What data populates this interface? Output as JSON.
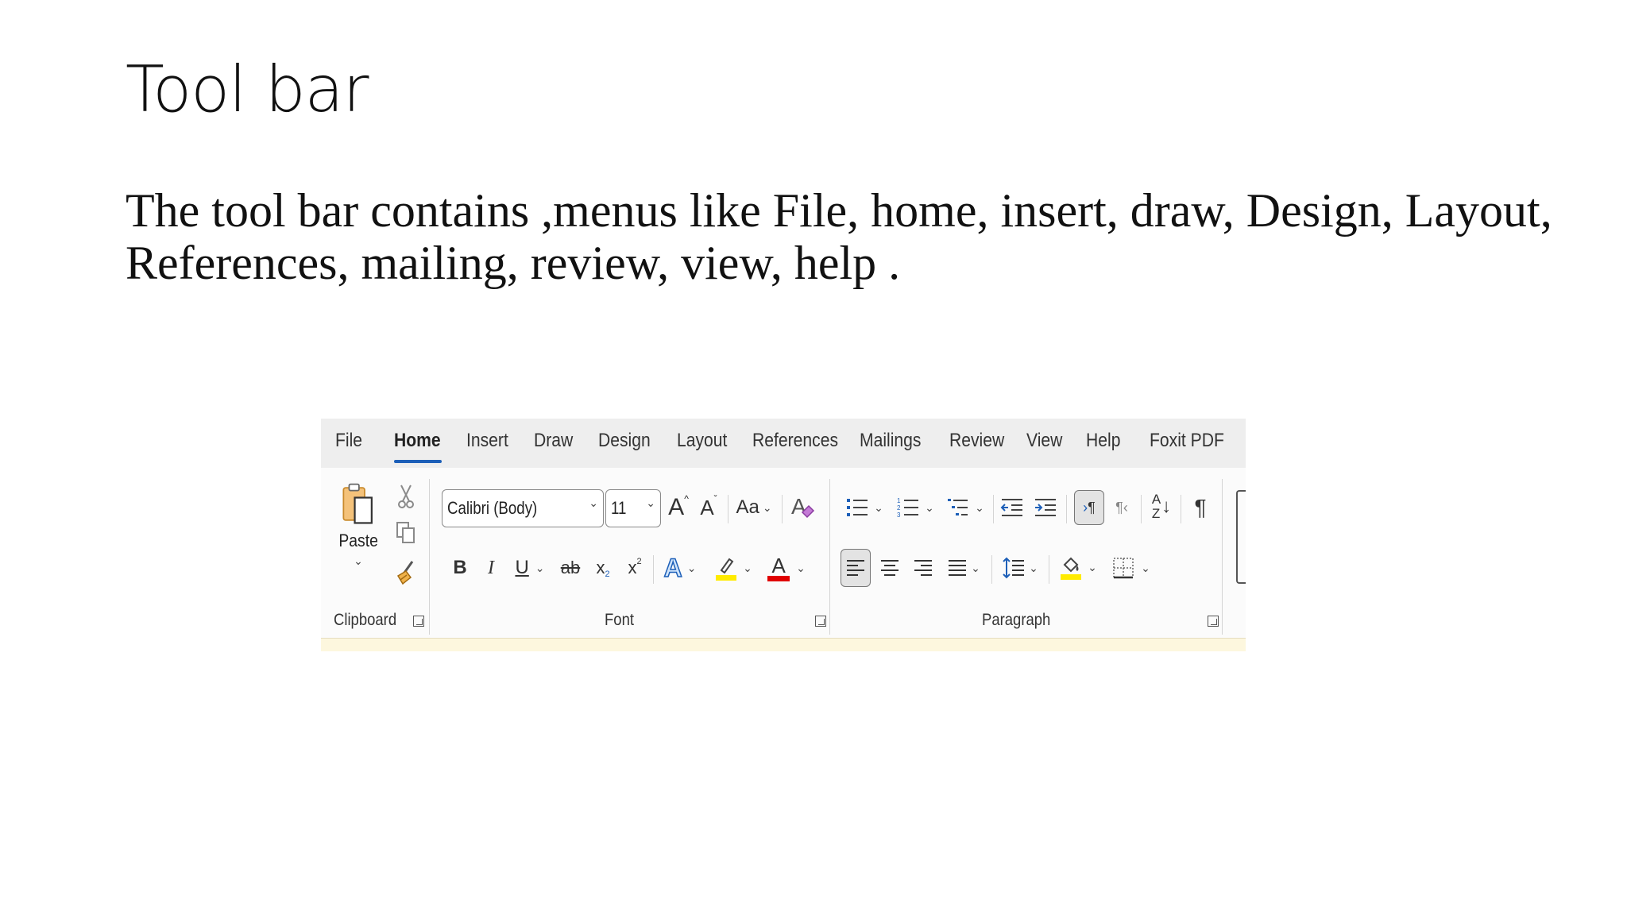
{
  "slide": {
    "title": "Tool bar",
    "body": "The tool bar contains ,menus like File, home, insert, draw, Design, Layout, References, mailing, review, view, help ."
  },
  "ribbon": {
    "tabs": [
      {
        "label": "File"
      },
      {
        "label": "Home",
        "active": true
      },
      {
        "label": "Insert"
      },
      {
        "label": "Draw"
      },
      {
        "label": "Design"
      },
      {
        "label": "Layout"
      },
      {
        "label": "References"
      },
      {
        "label": "Mailings"
      },
      {
        "label": "Review"
      },
      {
        "label": "View"
      },
      {
        "label": "Help"
      },
      {
        "label": "Foxit PDF"
      }
    ],
    "clipboard": {
      "paste_label": "Paste",
      "group_label": "Clipboard"
    },
    "font": {
      "font_name": "Calibri (Body)",
      "font_size": "11",
      "grow_glyph": "A",
      "shrink_glyph": "A",
      "case_label": "Aa",
      "bold": "B",
      "italic": "I",
      "underline": "U",
      "strike": "ab",
      "subscript": "x",
      "subscript_mark": "2",
      "superscript": "x",
      "superscript_mark": "2",
      "effects_glyph": "A",
      "color_glyph": "A",
      "group_label": "Font"
    },
    "paragraph": {
      "sort_top": "A",
      "sort_bottom": "Z",
      "pilcrow": "¶",
      "group_label": "Paragraph"
    },
    "colors": {
      "accent": "#1d5fb8",
      "highlight": "#ffeb00",
      "font_color": "#e00000",
      "paste_orange": "#e8a33d"
    }
  }
}
